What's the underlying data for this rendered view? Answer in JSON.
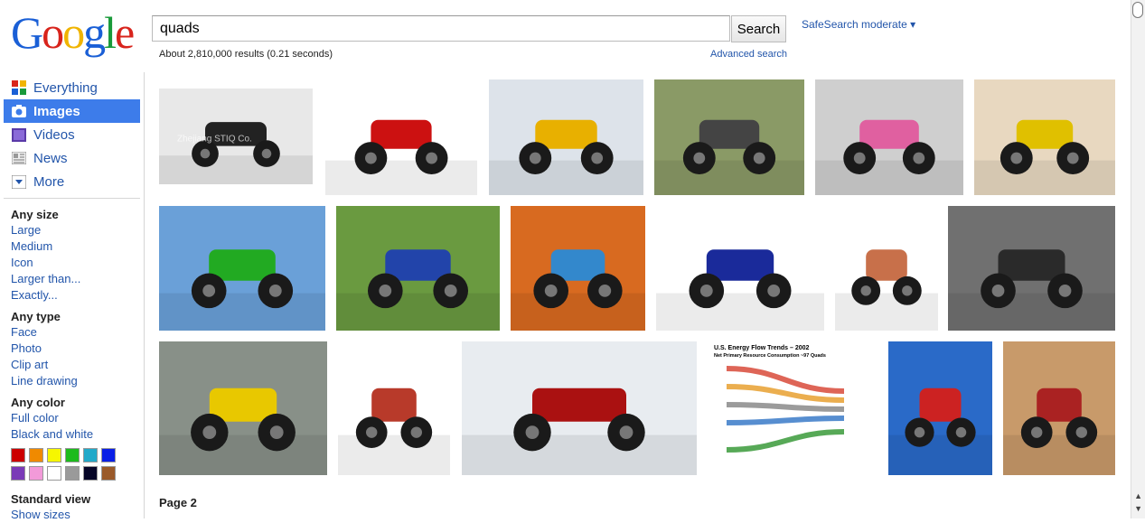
{
  "logo": {
    "letters": [
      "G",
      "o",
      "o",
      "g",
      "l",
      "e"
    ],
    "colors": [
      "#1a5fd6",
      "#d8241c",
      "#f0b400",
      "#1a5fd6",
      "#199a3a",
      "#d8241c"
    ]
  },
  "search": {
    "query": "quads",
    "button_label": "Search"
  },
  "safesearch_label": "SafeSearch moderate ▾",
  "result_stats": "About 2,810,000 results (0.21 seconds)",
  "advanced_search_label": "Advanced search",
  "nav": [
    {
      "label": "Everything",
      "icon": "everything-icon",
      "active": false
    },
    {
      "label": "Images",
      "icon": "camera-icon",
      "active": true
    },
    {
      "label": "Videos",
      "icon": "film-icon",
      "active": false
    },
    {
      "label": "News",
      "icon": "newspaper-icon",
      "active": false
    },
    {
      "label": "More",
      "icon": "chevron-down-icon",
      "active": false
    }
  ],
  "filters": {
    "size_heading": "Any size",
    "size_options": [
      "Large",
      "Medium",
      "Icon",
      "Larger than...",
      "Exactly..."
    ],
    "type_heading": "Any type",
    "type_options": [
      "Face",
      "Photo",
      "Clip art",
      "Line drawing"
    ],
    "color_heading": "Any color",
    "color_options": [
      "Full color",
      "Black and white"
    ],
    "swatch_colors": [
      "#cc0000",
      "#f08a00",
      "#f6f600",
      "#1dbb1d",
      "#22a9c9",
      "#0a1fe6",
      "#7a3ab7",
      "#f29ad9",
      "#ffffff",
      "#9a9a9a",
      "#060628",
      "#9a5a2a"
    ],
    "view_heading": "Standard view",
    "view_option": "Show sizes"
  },
  "page_label": "Page 2",
  "images": [
    {
      "subject": "black quad bike studio photo",
      "caption": "Zhejiang STIQ Co.",
      "bg": "#e8e8e8",
      "body": "#222222"
    },
    {
      "subject": "red ATV on white",
      "bg": "#ffffff",
      "body": "#cc1111"
    },
    {
      "subject": "toy quads in snow",
      "bg": "#dde3ea",
      "body": "#e8b000"
    },
    {
      "subject": "rider splashing through mud",
      "bg": "#8a9a66",
      "body": "#444444"
    },
    {
      "subject": "pink quad in garage",
      "bg": "#cfcfcf",
      "body": "#e060a0"
    },
    {
      "subject": "yellow ATV jumping on dune",
      "bg": "#e8d8c0",
      "body": "#e0c000"
    },
    {
      "subject": "video game ATV scene",
      "bg": "#6aa0d8",
      "body": "#22aa22"
    },
    {
      "subject": "kid on blue quad on grass",
      "bg": "#6a9a40",
      "body": "#2244aa"
    },
    {
      "subject": "men in blue buggy",
      "bg": "#d86a20",
      "body": "#3388cc"
    },
    {
      "subject": "blue ATV on white",
      "bg": "#ffffff",
      "body": "#1a2a9a"
    },
    {
      "subject": "leg muscles anatomy",
      "bg": "#ffffff",
      "body": "#c8704a"
    },
    {
      "subject": "forest trail black and white",
      "bg": "#707070",
      "body": "#2a2a2a"
    },
    {
      "subject": "kids riding quads",
      "bg": "#889088",
      "body": "#e8c800"
    },
    {
      "subject": "quadriceps anatomy close-up",
      "bg": "#ffffff",
      "body": "#b83a2a"
    },
    {
      "subject": "ATVs on antarctic ice",
      "bg": "#e8ecf0",
      "body": "#aa1111"
    },
    {
      "subject": "US energy flow trends diagram",
      "title": "U.S. Energy Flow Trends – 2002",
      "subtitle": "Net Primary Resource Consumption ~97 Quads",
      "bg": "#ffffff",
      "body": "#3a7a3a"
    },
    {
      "subject": "rider wheelie against blue sky",
      "bg": "#2a6ac8",
      "body": "#cc2222"
    },
    {
      "subject": "quads racing on dunes",
      "bg": "#c89a6a",
      "body": "#aa2222"
    }
  ]
}
